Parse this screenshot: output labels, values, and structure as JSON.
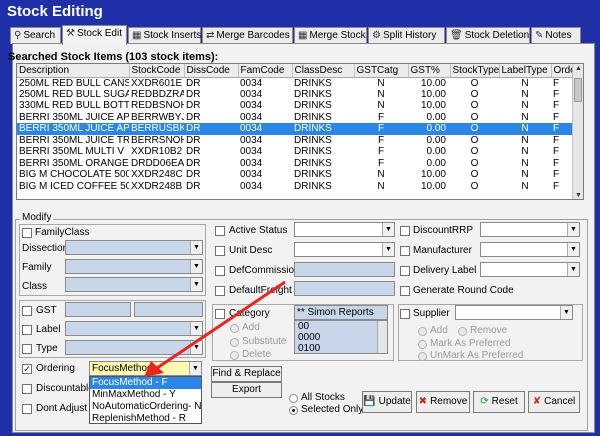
{
  "window": {
    "title": "Stock Editing"
  },
  "tabs": [
    {
      "label": "Search",
      "icon": "search-icon"
    },
    {
      "label": "Stock Edit",
      "icon": "tools-icon"
    },
    {
      "label": "Stock Inserts",
      "icon": "grid-icon"
    },
    {
      "label": "Merge Barcodes",
      "icon": "merge-icon"
    },
    {
      "label": "Merge Stock",
      "icon": "grid-icon"
    },
    {
      "label": "Split History",
      "icon": "split-icon"
    },
    {
      "label": "Stock Deletion",
      "icon": "trash-icon"
    },
    {
      "label": "Notes",
      "icon": "note-icon"
    }
  ],
  "grid": {
    "title": "Searched Stock Items (103 stock items):",
    "columns": [
      "Description",
      "StockCode",
      "DissCode",
      "FamCode",
      "ClassDesc",
      "GSTCatg",
      "GST%",
      "StockType",
      "LabelType",
      "Orde"
    ],
    "rows": [
      [
        "250ML RED BULL CANS",
        "XXDR601E",
        "DR",
        "0034",
        "DRINKS",
        "N",
        "10.00",
        "O",
        "N",
        "F"
      ],
      [
        "250ML RED BULL SUGAR...",
        "REDBDZRA",
        "DR",
        "0034",
        "DRINKS",
        "N",
        "10.00",
        "O",
        "N",
        "F"
      ],
      [
        "330ML RED BULL BOTTLES",
        "REDBSNOH",
        "DR",
        "0034",
        "DRINKS",
        "N",
        "10.00",
        "O",
        "N",
        "F"
      ],
      [
        "BERRI 350ML JUICE APPLE",
        "BERRWBYJ",
        "DR",
        "0034",
        "DRINKS",
        "F",
        "0.00",
        "O",
        "N",
        "F"
      ],
      [
        "BERRI 350ML JUICE APP...",
        "BERRUSBK",
        "DR",
        "0034",
        "DRINKS",
        "F",
        "0.00",
        "O",
        "N",
        "F"
      ],
      [
        "BERRI 350ML JUICE TRO...",
        "BERRSNOH",
        "DR",
        "0034",
        "DRINKS",
        "F",
        "0.00",
        "O",
        "N",
        "F"
      ],
      [
        "BERRI 350ML MULTI V",
        "XXDR10B2",
        "DR",
        "0034",
        "DRINKS",
        "F",
        "0.00",
        "O",
        "N",
        "F"
      ],
      [
        "BERRI 350ML ORANGE",
        "DRDD06EA",
        "DR",
        "0034",
        "DRINKS",
        "F",
        "0.00",
        "O",
        "N",
        "F"
      ],
      [
        "BIG M CHOCOLATE 500ML",
        "XXDR248C",
        "DR",
        "0034",
        "DRINKS",
        "N",
        "10.00",
        "O",
        "N",
        "F"
      ],
      [
        "BIG M ICED COFFEE 500ML",
        "XXDR248B",
        "DR",
        "0034",
        "DRINKS",
        "N",
        "10.00",
        "O",
        "N",
        "F"
      ]
    ],
    "selected_row": 4
  },
  "modify": {
    "legend": "Modify",
    "family_class": "FamilyClass",
    "dissection": "Dissection",
    "family": "Family",
    "class": "Class",
    "active_status": "Active Status",
    "unit_desc": "Unit Desc",
    "def_commission": "DefCommission",
    "default_freight": "DefaultFreight",
    "discount_rrp": "DiscountRRP",
    "manufacturer": "Manufacturer",
    "delivery_label": "Delivery Label",
    "generate_round_code": "Generate Round Code",
    "gst": "GST",
    "label": "Label",
    "type": "Type",
    "ordering": "Ordering",
    "ordering_value": "FocusMethod",
    "discountable": "Discountable",
    "dont_adjust": "Dont Adjust C",
    "category": "Category",
    "category_value": "** Simon Reports",
    "category_list": [
      "00",
      "0000",
      "0100"
    ],
    "cat_add": "Add",
    "cat_substitute": "Substitute",
    "cat_delete": "Delete",
    "supplier": "Supplier",
    "sup_add": "Add",
    "sup_remove": "Remove",
    "mark_preferred": "Mark As Preferred",
    "unmark_preferred": "UnMark As Preferred",
    "find_replace": "Find & Replace",
    "export": "Export",
    "all_stocks": "All Stocks",
    "selected_only": "Selected Only",
    "update": "Update",
    "remove": "Remove",
    "reset": "Reset",
    "cancel": "Cancel"
  },
  "ordering_options": [
    "FocusMethod - F",
    "MinMaxMethod - Y",
    "NoAutomaticOrdering- N",
    "ReplenishMethod - R"
  ],
  "colors": {
    "title_bar": "#1f2fa8",
    "selection": "#2b86e8",
    "field_bg": "#c8d6ea",
    "annotation_arrow": "#e8251f"
  }
}
